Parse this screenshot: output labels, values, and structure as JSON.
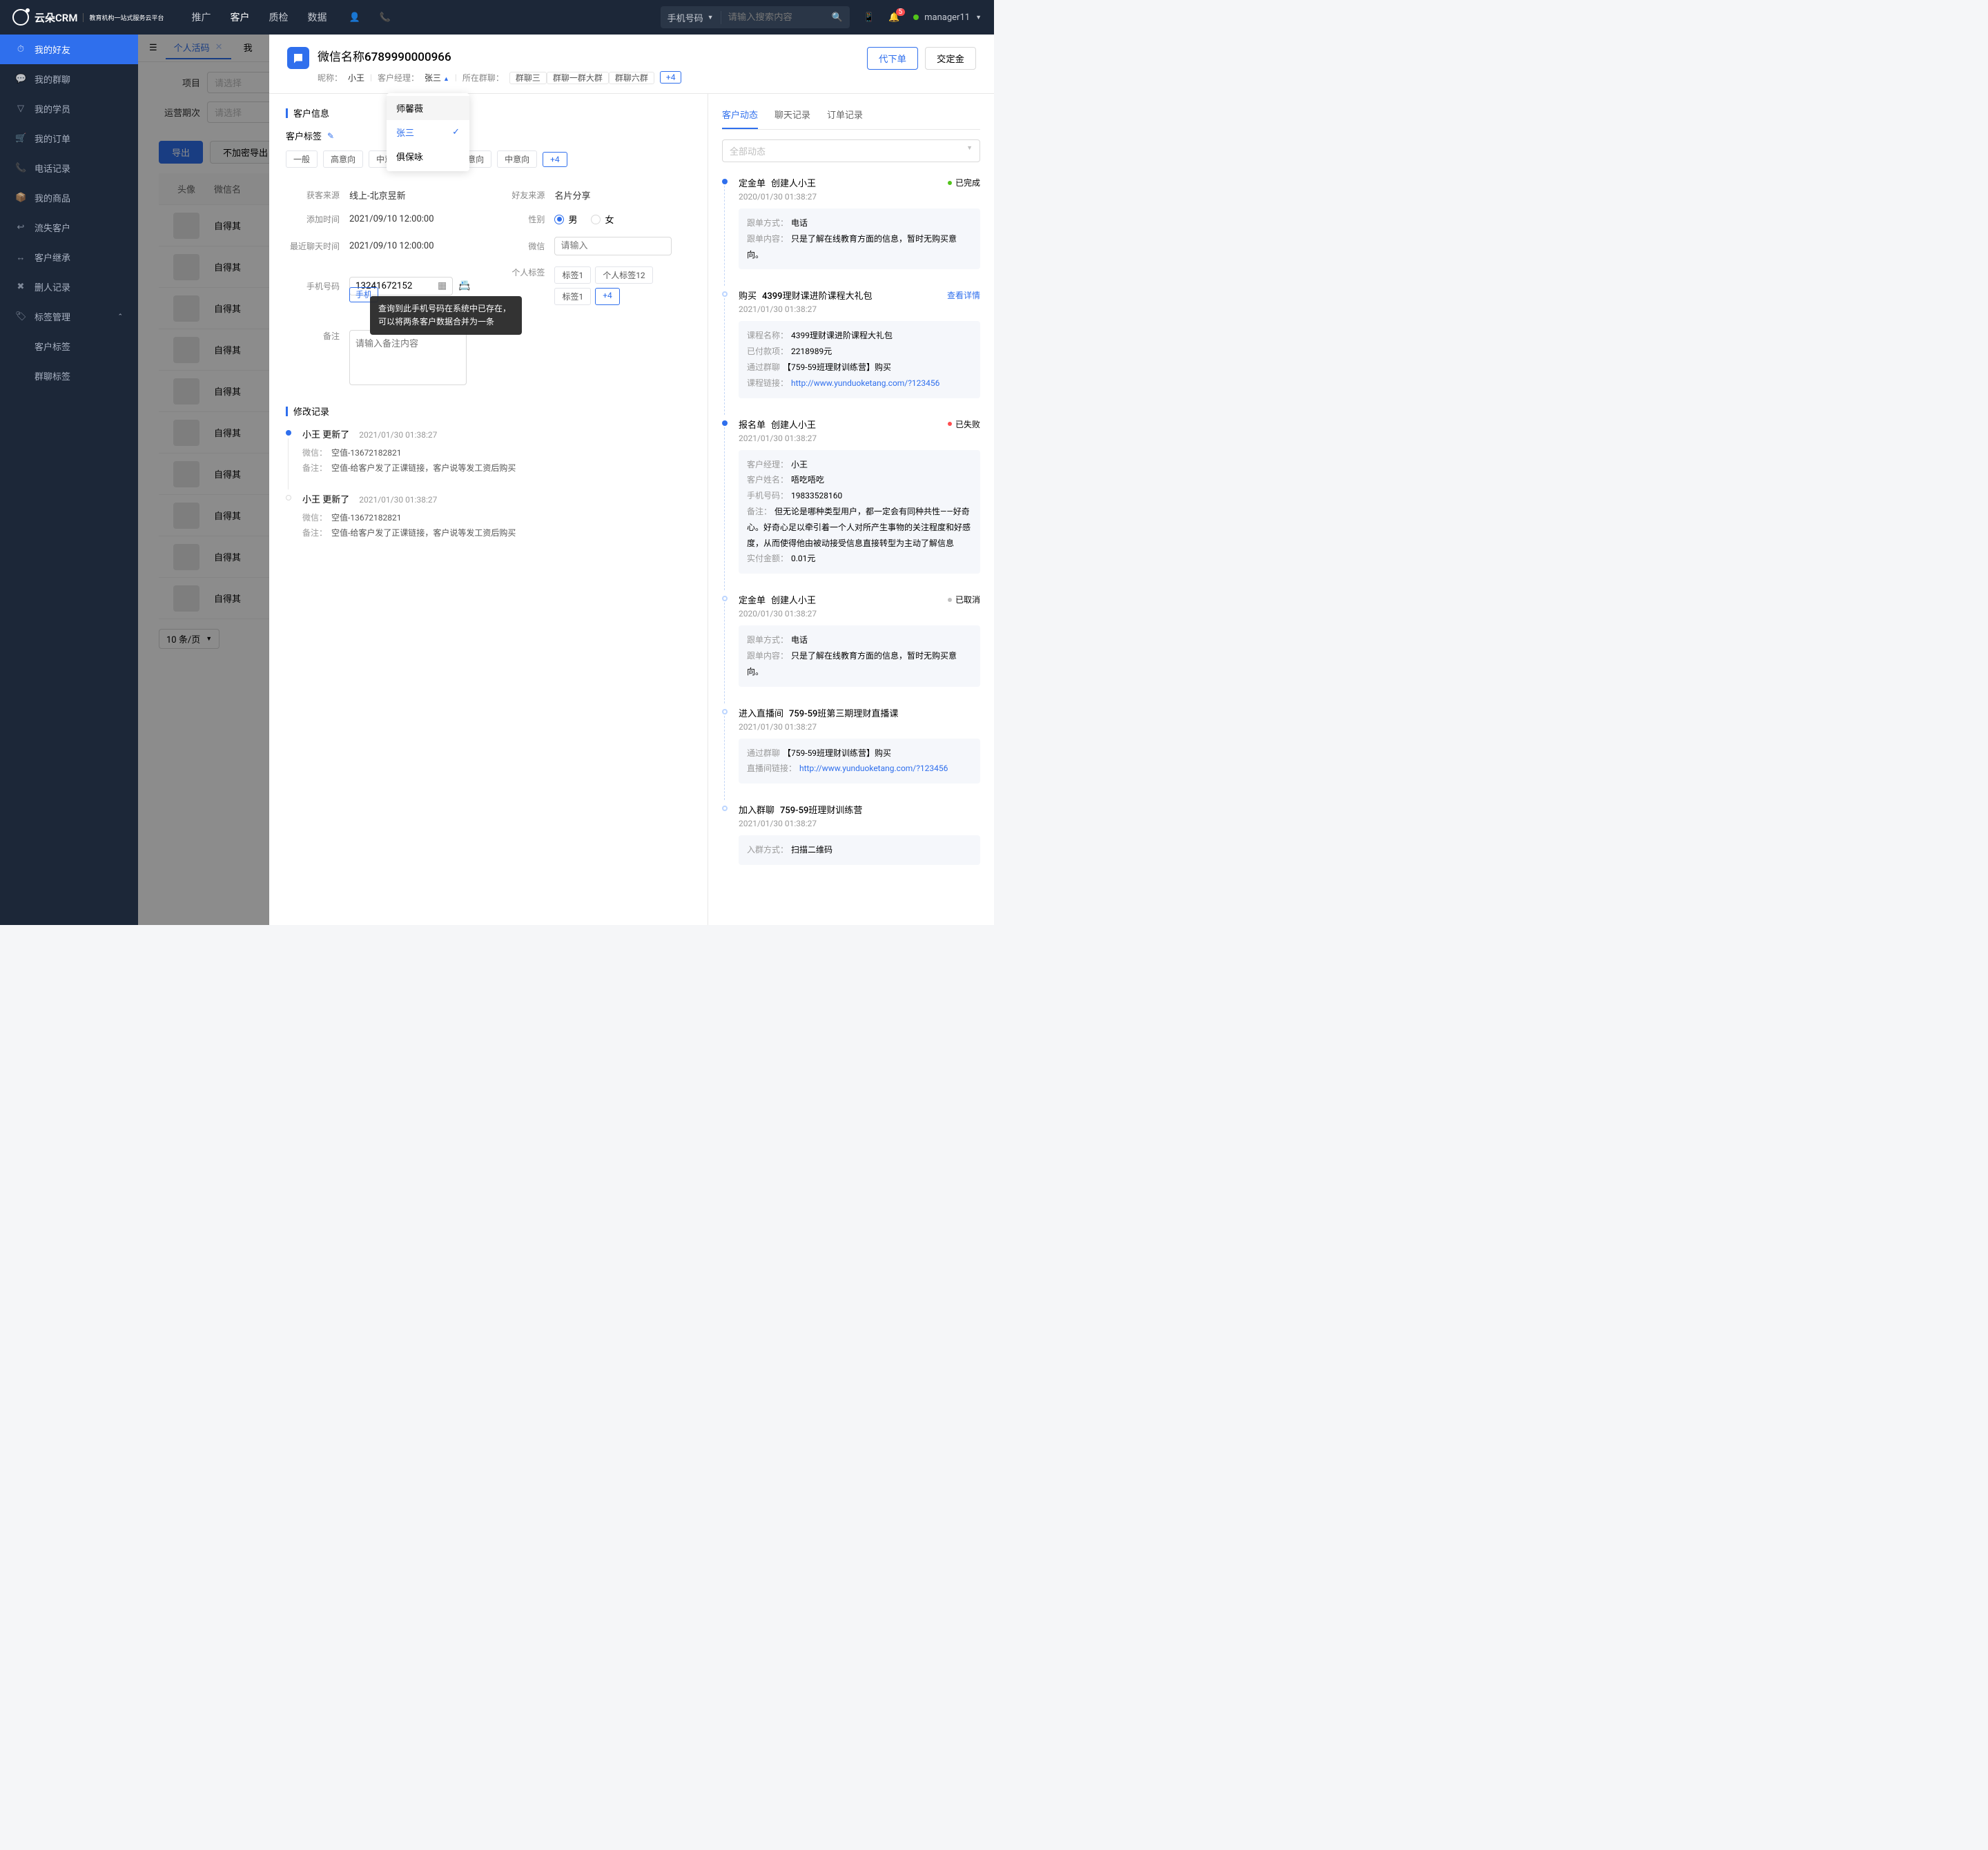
{
  "top": {
    "logo": "云朵CRM",
    "logo_sub": "教育机构一站式服务云平台",
    "nav": [
      "推广",
      "客户",
      "质检",
      "数据"
    ],
    "search_type": "手机号码",
    "search_ph": "请输入搜索内容",
    "badge_count": "5",
    "user": "manager11"
  },
  "sidebar": [
    {
      "ic": "⏱",
      "t": "我的好友",
      "act": true
    },
    {
      "ic": "💬",
      "t": "我的群聊"
    },
    {
      "ic": "▽",
      "t": "我的学员"
    },
    {
      "ic": "🛒",
      "t": "我的订单"
    },
    {
      "ic": "📞",
      "t": "电话记录"
    },
    {
      "ic": "📦",
      "t": "我的商品"
    },
    {
      "ic": "↩",
      "t": "流失客户"
    },
    {
      "ic": "↔",
      "t": "客户继承"
    },
    {
      "ic": "✖",
      "t": "删人记录"
    },
    {
      "ic": "🏷",
      "t": "标签管理",
      "exp": true
    }
  ],
  "side_sub": [
    "客户标签",
    "群聊标签"
  ],
  "tabs": [
    {
      "t": "个人活码",
      "act": true
    },
    {
      "t": "我"
    }
  ],
  "filters": {
    "f1": "项目",
    "f2": "运营期次",
    "ph": "请选择"
  },
  "actions": {
    "export": "导出",
    "noenc": "不加密导出"
  },
  "table": {
    "h1": "头像",
    "h2": "微信名",
    "rows": [
      "自得其",
      "自得其",
      "自得其",
      "自得其",
      "自得其",
      "自得其",
      "自得其",
      "自得其",
      "自得其",
      "自得其"
    ]
  },
  "pager": "10 条/页",
  "drawer": {
    "title": "微信名称6789990000966",
    "nickname_l": "昵称：",
    "nickname": "小王",
    "mgr_l": "客户经理：",
    "mgr": "张三",
    "group_l": "所在群聊：",
    "groups": [
      "群聊三",
      "群聊一群大群",
      "群聊六群"
    ],
    "group_more": "+4",
    "act1": "代下单",
    "act2": "交定金"
  },
  "dd": [
    "师馨薇",
    "张三",
    "俱保咏"
  ],
  "sec_info": "客户信息",
  "tags_l": "客户标签",
  "tags": [
    "一般",
    "高意向",
    "中意向",
    "一般",
    "高意向",
    "中意向"
  ],
  "tags_more": "+4",
  "info": {
    "src_l": "获客来源",
    "src": "线上-北京昱新",
    "fr_l": "好友来源",
    "fr": "名片分享",
    "add_l": "添加时间",
    "add": "2021/09/10 12:00:00",
    "sex_l": "性别",
    "male": "男",
    "female": "女",
    "chat_l": "最近聊天时间",
    "chat": "2021/09/10 12:00:00",
    "wx_l": "微信",
    "wx_ph": "请输入",
    "phone_l": "手机号码",
    "phone": "13241672152",
    "phone_link": "手机",
    "tooltip": "查询到此手机号码在系统中已存在，可以将两条客户数据合并为一条",
    "ptag_l": "个人标签",
    "ptags": [
      "标签1",
      "个人标签12",
      "标签1"
    ],
    "ptag_more": "+4",
    "note_l": "备注",
    "note_ph": "请输入备注内容"
  },
  "sec_hist": "修改记录",
  "hist": [
    {
      "who": "小王  更新了",
      "date": "2021/01/30  01:38:27",
      "rows": [
        {
          "k": "微信：",
          "v": "空值-13672182821"
        },
        {
          "k": "备注：",
          "v": "空值-给客户发了正课链接，客户说等发工资后购买"
        }
      ]
    },
    {
      "who": "小王  更新了",
      "date": "2021/01/30  01:38:27",
      "rows": [
        {
          "k": "微信：",
          "v": "空值-13672182821"
        },
        {
          "k": "备注：",
          "v": "空值-给客户发了正课链接，客户说等发工资后购买"
        }
      ]
    }
  ],
  "right": {
    "tabs": [
      "客户动态",
      "聊天记录",
      "订单记录"
    ],
    "sel": "全部动态",
    "activities": [
      {
        "solid": true,
        "t1": "定金单",
        "t2": "创建人小王",
        "date": "2020/01/30  01:38:27",
        "status": "已完成",
        "stc": "st-green",
        "card": [
          {
            "k": "跟单方式：",
            "v": "电话"
          },
          {
            "k": "跟单内容：",
            "v": "只是了解在线教育方面的信息，暂时无购买意向。"
          }
        ]
      },
      {
        "t1": "购买",
        "t2": "4399理财课进阶课程大礼包",
        "date": "2021/01/30  01:38:27",
        "view": "查看详情",
        "card": [
          {
            "k": "课程名称：",
            "v": "4399理财课进阶课程大礼包"
          },
          {
            "k": "已付款项：",
            "v": "2218989元"
          },
          {
            "k": "通过群聊",
            "v": "【759-59班理财训练营】购买"
          },
          {
            "k": "课程链接：",
            "v": "http://www.yunduoketang.com/?123456",
            "link": true
          }
        ]
      },
      {
        "solid": true,
        "t1": "报名单",
        "t2": "创建人小王",
        "date": "2021/01/30  01:38:27",
        "status": "已失败",
        "stc": "st-red",
        "card": [
          {
            "k": "客户经理：",
            "v": "小王"
          },
          {
            "k": "客户姓名：",
            "v": "唔吃唔吃"
          },
          {
            "k": "手机号码：",
            "v": "19833528160"
          },
          {
            "k": "备注：",
            "v": "但无论是哪种类型用户，都一定会有同种共性——好奇心。好奇心足以牵引着一个人对所产生事物的关注程度和好感度，从而使得他由被动接受信息直接转型为主动了解信息"
          },
          {
            "k": "实付金额：",
            "v": "0.01元"
          }
        ]
      },
      {
        "t1": "定金单",
        "t2": "创建人小王",
        "date": "2020/01/30  01:38:27",
        "status": "已取消",
        "stc": "st-gray",
        "card": [
          {
            "k": "跟单方式：",
            "v": "电话"
          },
          {
            "k": "跟单内容：",
            "v": "只是了解在线教育方面的信息，暂时无购买意向。"
          }
        ]
      },
      {
        "t1": "进入直播间",
        "t2": "759-59班第三期理财直播课",
        "date": "2021/01/30  01:38:27",
        "card": [
          {
            "k": "通过群聊",
            "v": "【759-59班理财训练营】购买"
          },
          {
            "k": "直播间链接：",
            "v": "http://www.yunduoketang.com/?123456",
            "link": true
          }
        ]
      },
      {
        "t1": "加入群聊",
        "t2": "759-59班理财训练营",
        "date": "2021/01/30  01:38:27",
        "card": [
          {
            "k": "入群方式：",
            "v": "扫描二维码"
          }
        ]
      }
    ]
  }
}
